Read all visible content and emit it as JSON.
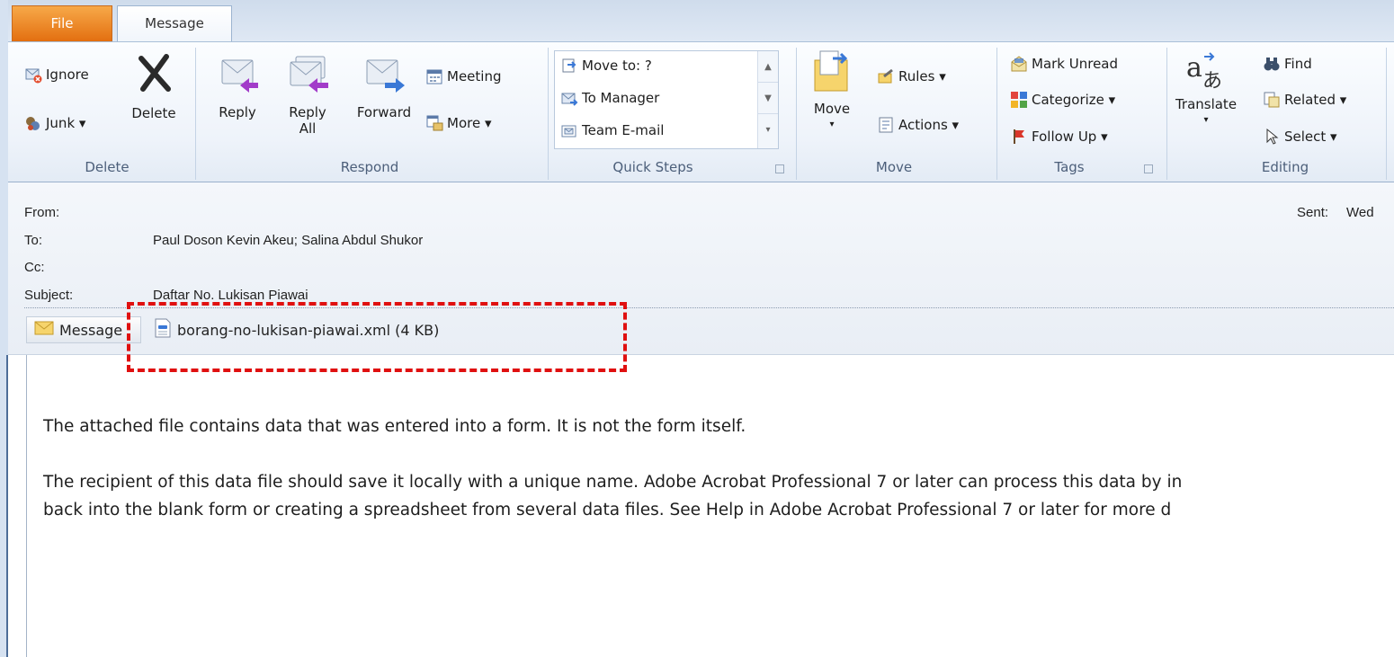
{
  "tabs": {
    "file": "File",
    "message": "Message"
  },
  "ribbon": {
    "delete_group": {
      "label": "Delete",
      "ignore": "Ignore",
      "junk": "Junk ▾",
      "delete": "Delete"
    },
    "respond_group": {
      "label": "Respond",
      "reply": "Reply",
      "reply_all_1": "Reply",
      "reply_all_2": "All",
      "forward": "Forward",
      "meeting": "Meeting",
      "more": "More ▾"
    },
    "quick_steps_group": {
      "label": "Quick Steps",
      "items": [
        "Move to: ?",
        "To Manager",
        "Team E-mail"
      ]
    },
    "move_group": {
      "label": "Move",
      "move": "Move",
      "rules": "Rules ▾",
      "actions": "Actions ▾"
    },
    "tags_group": {
      "label": "Tags",
      "mark_unread": "Mark Unread",
      "categorize": "Categorize ▾",
      "follow_up": "Follow Up ▾"
    },
    "editing_group": {
      "label": "Editing",
      "translate": "Translate",
      "find": "Find",
      "related": "Related ▾",
      "select": "Select ▾"
    }
  },
  "header": {
    "from_label": "From:",
    "to_label": "To:",
    "to_value": "Paul Doson  Kevin Akeu; Salina Abdul Shukor",
    "cc_label": "Cc:",
    "subject_label": "Subject:",
    "subject_value": "Daftar No. Lukisan Piawai",
    "sent_label": "Sent:",
    "sent_value": "Wed"
  },
  "attachments": {
    "message_tab": "Message",
    "file": "borang-no-lukisan-piawai.xml (4 KB)"
  },
  "body": {
    "line1": "The attached file contains data that was entered into a form. It is not the form itself.",
    "line2": "The recipient of this data file should save it locally with a unique name. Adobe Acrobat Professional 7 or later can process this data by in",
    "line3": "back into the blank form or creating a spreadsheet from several data files. See Help in Adobe Acrobat Professional 7 or later for more d"
  },
  "colors": {
    "highlight": "#e01010",
    "file_tab": "#e36f10",
    "ribbon_bg": "#eef3fa"
  }
}
